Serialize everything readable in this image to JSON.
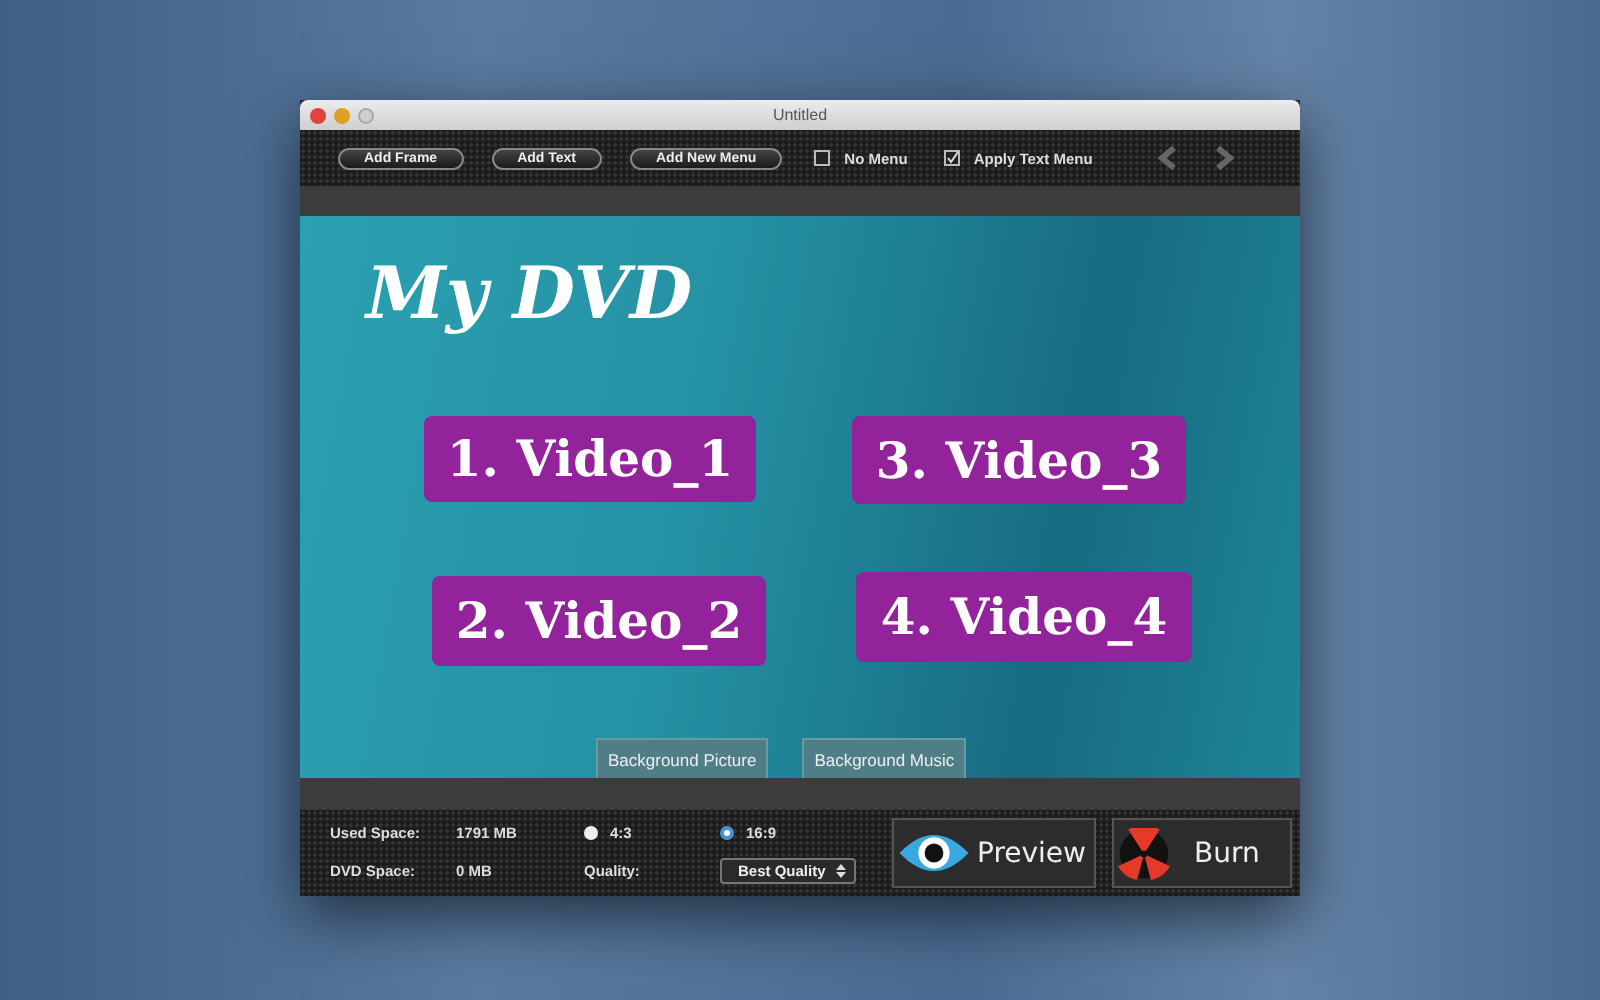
{
  "window": {
    "title": "Untitled"
  },
  "toolbar": {
    "buttons": [
      "Add Frame",
      "Add Text",
      "Add New Menu"
    ],
    "checkboxes": [
      {
        "label": "No Menu",
        "checked": false
      },
      {
        "label": "Apply Text Menu",
        "checked": true
      }
    ],
    "nav": [
      {
        "kind": "back",
        "disabled": true
      },
      {
        "kind": "forward",
        "disabled": true
      }
    ]
  },
  "canvas": {
    "title": "My DVD",
    "menu_items": [
      {
        "label": "1. Video_1"
      },
      {
        "label": "3. Video_3"
      },
      {
        "label": "2. Video_2"
      },
      {
        "label": "4. Video_4"
      }
    ],
    "tabs": [
      {
        "label": "Background Picture",
        "selected": false
      },
      {
        "label": "Background Music",
        "selected": false
      }
    ]
  },
  "status": {
    "used_space_label": "Used Space:",
    "used_space": "1791 MB",
    "dvd_space_label": "DVD Space:",
    "dvd_space": "0 MB",
    "aspect": [
      {
        "label": "4:3",
        "selected": false
      },
      {
        "label": "16:9",
        "selected": true
      }
    ],
    "quality_label": "Quality:",
    "quality": "Best Quality"
  },
  "actions": [
    {
      "kind": "preview",
      "label": "Preview"
    },
    {
      "kind": "burn",
      "label": "Burn"
    }
  ]
}
